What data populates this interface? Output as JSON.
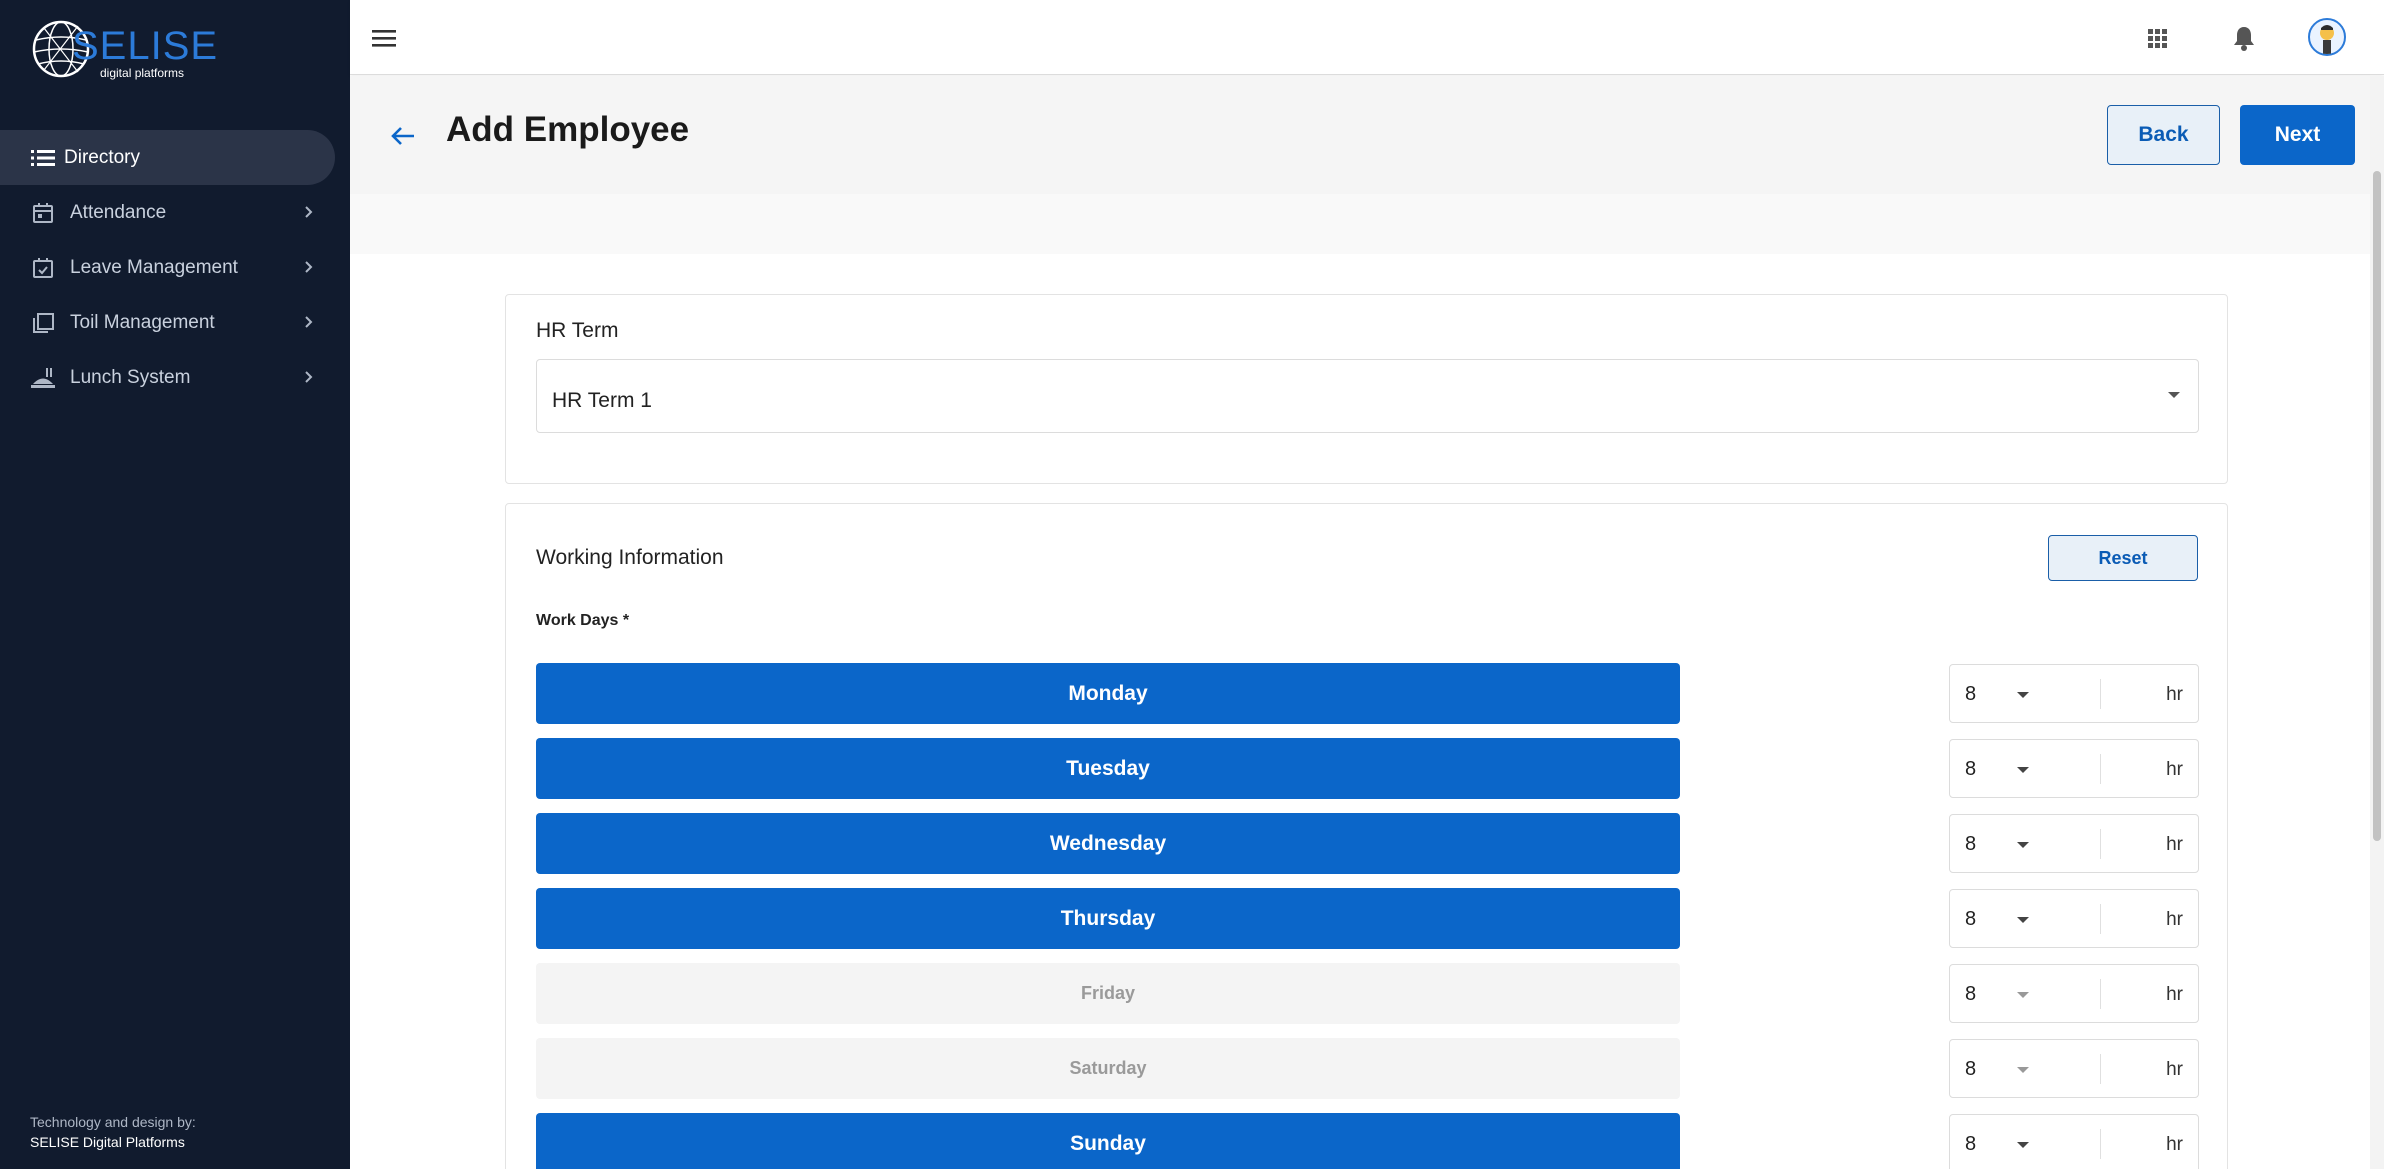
{
  "brand": {
    "logo_text": "SELISE",
    "logo_sub": "digital platforms"
  },
  "sidebar": {
    "items": [
      {
        "label": "Directory",
        "icon": "list-icon",
        "active": true
      },
      {
        "label": "Attendance",
        "icon": "calendar-icon"
      },
      {
        "label": "Leave Management",
        "icon": "calendar-check-icon"
      },
      {
        "label": "Toil Management",
        "icon": "copy-icon"
      },
      {
        "label": "Lunch System",
        "icon": "lunch-icon"
      }
    ],
    "footer_line1": "Technology and design by:",
    "footer_line2": "SELISE Digital Platforms"
  },
  "header": {
    "title": "Add Employee",
    "back_label": "Back",
    "next_label": "Next"
  },
  "hr_term": {
    "title": "HR Term",
    "selected": "HR Term 1"
  },
  "working_info": {
    "title": "Working Information",
    "reset_label": "Reset",
    "work_days_label": "Work Days *",
    "unit": "hr",
    "days": [
      {
        "label": "Monday",
        "selected": true,
        "hours": "8"
      },
      {
        "label": "Tuesday",
        "selected": true,
        "hours": "8"
      },
      {
        "label": "Wednesday",
        "selected": true,
        "hours": "8"
      },
      {
        "label": "Thursday",
        "selected": true,
        "hours": "8"
      },
      {
        "label": "Friday",
        "selected": false,
        "hours": "8"
      },
      {
        "label": "Saturday",
        "selected": false,
        "hours": "8"
      },
      {
        "label": "Sunday",
        "selected": true,
        "hours": "8"
      }
    ]
  },
  "colors": {
    "sidebar_bg": "#111b2e",
    "primary": "#0b66c9",
    "active_nav": "#2b3448"
  }
}
